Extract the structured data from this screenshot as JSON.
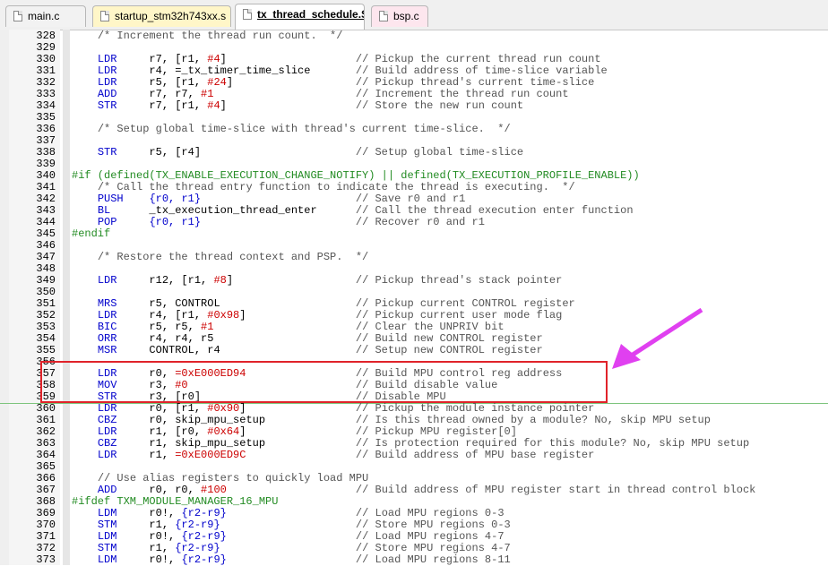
{
  "tabs": [
    {
      "label": "main.c",
      "active": false,
      "color": "#f2f2f2"
    },
    {
      "label": "startup_stm32h743xx.s",
      "active": false,
      "color": "#fff6c8"
    },
    {
      "label": "tx_thread_schedule.S",
      "active": true,
      "color": "#ffffff"
    },
    {
      "label": "bsp.c",
      "active": false,
      "color": "#fde6ee"
    }
  ],
  "editor": {
    "lines": [
      {
        "n": "328",
        "code": "    /* Increment the thread run count.  */"
      },
      {
        "n": "329",
        "code": ""
      },
      {
        "n": "330",
        "code": "    LDR     r7, [r1, #4]                    // Pickup the current thread run count"
      },
      {
        "n": "331",
        "code": "    LDR     r4, =_tx_timer_time_slice       // Build address of time-slice variable"
      },
      {
        "n": "332",
        "code": "    LDR     r5, [r1, #24]                   // Pickup thread's current time-slice"
      },
      {
        "n": "333",
        "code": "    ADD     r7, r7, #1                      // Increment the thread run count"
      },
      {
        "n": "334",
        "code": "    STR     r7, [r1, #4]                    // Store the new run count"
      },
      {
        "n": "335",
        "code": ""
      },
      {
        "n": "336",
        "code": "    /* Setup global time-slice with thread's current time-slice.  */"
      },
      {
        "n": "337",
        "code": ""
      },
      {
        "n": "338",
        "code": "    STR     r5, [r4]                        // Setup global time-slice"
      },
      {
        "n": "339",
        "code": ""
      },
      {
        "n": "340",
        "code": "#if (defined(TX_ENABLE_EXECUTION_CHANGE_NOTIFY) || defined(TX_EXECUTION_PROFILE_ENABLE))"
      },
      {
        "n": "341",
        "code": "    /* Call the thread entry function to indicate the thread is executing.  */"
      },
      {
        "n": "342",
        "code": "    PUSH    {r0, r1}                        // Save r0 and r1"
      },
      {
        "n": "343",
        "code": "    BL      _tx_execution_thread_enter      // Call the thread execution enter function"
      },
      {
        "n": "344",
        "code": "    POP     {r0, r1}                        // Recover r0 and r1"
      },
      {
        "n": "345",
        "code": "#endif"
      },
      {
        "n": "346",
        "code": ""
      },
      {
        "n": "347",
        "code": "    /* Restore the thread context and PSP.  */"
      },
      {
        "n": "348",
        "code": ""
      },
      {
        "n": "349",
        "code": "    LDR     r12, [r1, #8]                   // Pickup thread's stack pointer"
      },
      {
        "n": "350",
        "code": ""
      },
      {
        "n": "351",
        "code": "    MRS     r5, CONTROL                     // Pickup current CONTROL register"
      },
      {
        "n": "352",
        "code": "    LDR     r4, [r1, #0x98]                 // Pickup current user mode flag"
      },
      {
        "n": "353",
        "code": "    BIC     r5, r5, #1                      // Clear the UNPRIV bit"
      },
      {
        "n": "354",
        "code": "    ORR     r4, r4, r5                      // Build new CONTROL register"
      },
      {
        "n": "355",
        "code": "    MSR     CONTROL, r4                     // Setup new CONTROL register"
      },
      {
        "n": "356",
        "code": ""
      },
      {
        "n": "357",
        "code": "    LDR     r0, =0xE000ED94                 // Build MPU control reg address"
      },
      {
        "n": "358",
        "code": "    MOV     r3, #0                          // Build disable value"
      },
      {
        "n": "359",
        "code": "    STR     r3, [r0]                        // Disable MPU"
      },
      {
        "n": "360",
        "code": "    LDR     r0, [r1, #0x90]                 // Pickup the module instance pointer"
      },
      {
        "n": "361",
        "code": "    CBZ     r0, skip_mpu_setup              // Is this thread owned by a module? No, skip MPU setup"
      },
      {
        "n": "362",
        "code": "    LDR     r1, [r0, #0x64]                 // Pickup MPU register[0]"
      },
      {
        "n": "363",
        "code": "    CBZ     r1, skip_mpu_setup              // Is protection required for this module? No, skip MPU setup"
      },
      {
        "n": "364",
        "code": "    LDR     r1, =0xE000ED9C                 // Build address of MPU base register"
      },
      {
        "n": "365",
        "code": ""
      },
      {
        "n": "366",
        "code": "    // Use alias registers to quickly load MPU"
      },
      {
        "n": "367",
        "code": "    ADD     r0, r0, #100                    // Build address of MPU register start in thread control block"
      },
      {
        "n": "368",
        "code": "#ifdef TXM_MODULE_MANAGER_16_MPU"
      },
      {
        "n": "369",
        "code": "    LDM     r0!, {r2-r9}                    // Load MPU regions 0-3"
      },
      {
        "n": "370",
        "code": "    STM     r1, {r2-r9}                     // Store MPU regions 0-3"
      },
      {
        "n": "371",
        "code": "    LDM     r0!, {r2-r9}                    // Load MPU regions 4-7"
      },
      {
        "n": "372",
        "code": "    STM     r1, {r2-r9}                     // Store MPU regions 4-7"
      },
      {
        "n": "373",
        "code": "    LDM     r0!, {r2-r9}                    // Load MPU regions 8-11"
      }
    ]
  },
  "colors": {
    "highlight_box": "#e0232a",
    "annotation_arrow": "#e040f0",
    "instruction": "#0000cc",
    "immediate": "#cc0000",
    "preprocessor": "#228b22"
  }
}
